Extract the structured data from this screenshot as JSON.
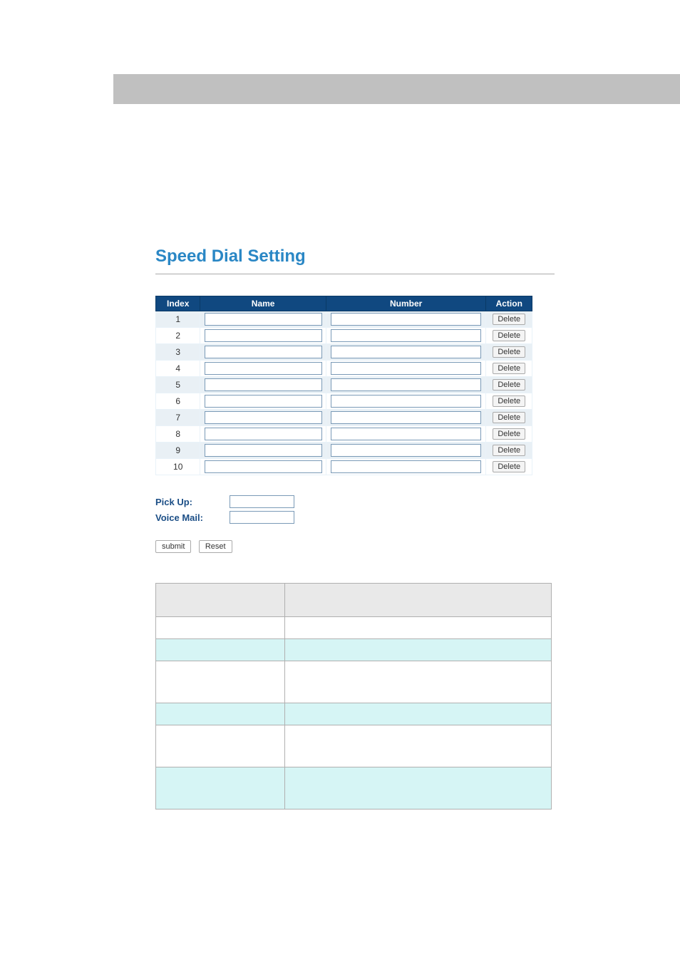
{
  "page": {
    "title": "Speed Dial Setting"
  },
  "table": {
    "headers": {
      "index": "Index",
      "name": "Name",
      "number": "Number",
      "action": "Action"
    },
    "delete_label": "Delete",
    "rows": [
      {
        "index": "1",
        "name": "",
        "number": ""
      },
      {
        "index": "2",
        "name": "",
        "number": ""
      },
      {
        "index": "3",
        "name": "",
        "number": ""
      },
      {
        "index": "4",
        "name": "",
        "number": ""
      },
      {
        "index": "5",
        "name": "",
        "number": ""
      },
      {
        "index": "6",
        "name": "",
        "number": ""
      },
      {
        "index": "7",
        "name": "",
        "number": ""
      },
      {
        "index": "8",
        "name": "",
        "number": ""
      },
      {
        "index": "9",
        "name": "",
        "number": ""
      },
      {
        "index": "10",
        "name": "",
        "number": ""
      }
    ]
  },
  "fields": {
    "pickup_label": "Pick Up:",
    "pickup_value": "",
    "voicemail_label": "Voice Mail:",
    "voicemail_value": ""
  },
  "buttons": {
    "submit": "submit",
    "reset": "Reset"
  }
}
